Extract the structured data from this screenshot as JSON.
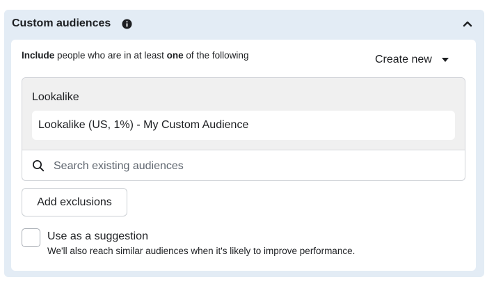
{
  "panel": {
    "title": "Custom audiences",
    "info_icon": "info-circle-icon",
    "collapse_icon": "chevron-up-icon"
  },
  "include_line": {
    "bold_prefix": "Include",
    "text_middle": " people who are in at least ",
    "bold_count": "one",
    "text_suffix": " of the following"
  },
  "create_new": {
    "label": "Create new",
    "icon": "caret-down-icon"
  },
  "lookalike": {
    "section_label": "Lookalike",
    "selected_audience": "Lookalike (US, 1%) - My Custom Audience"
  },
  "search": {
    "placeholder": "Search existing audiences",
    "icon": "search-icon"
  },
  "exclusions": {
    "button_label": "Add exclusions"
  },
  "suggestion": {
    "checked": false,
    "label": "Use as a suggestion",
    "help_text": "We'll also reach similar audiences when it's likely to improve performance."
  },
  "colors": {
    "panel_bg": "#e3ecf5",
    "section_bg": "#f0f0f0",
    "text": "#1c1e21",
    "border": "#d0d3d8"
  }
}
